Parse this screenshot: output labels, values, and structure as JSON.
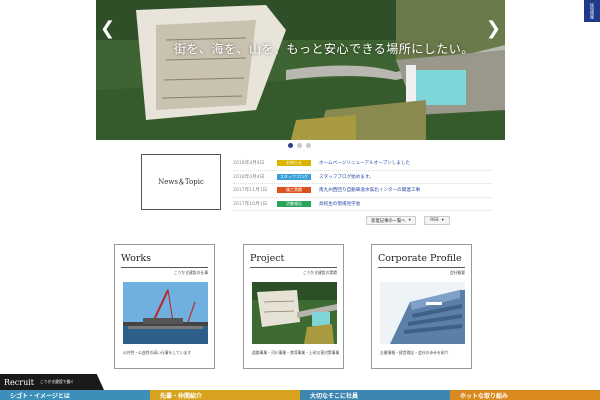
{
  "hero": {
    "tagline": "街を、海を、山を、もっと安心できる場所にしたい。",
    "prev_icon": "chevron-left-icon",
    "next_icon": "chevron-right-icon"
  },
  "slider": {
    "count": 3,
    "active": 0
  },
  "side_tab": {
    "label": "採用情報"
  },
  "news": {
    "heading": "News＆Topic",
    "items": [
      {
        "date": "2018年4月4日",
        "badge": "お知らせ",
        "badge_color": "#d9b500",
        "title": "ホームページリニューアルオープンしました"
      },
      {
        "date": "2018年4月4日",
        "badge": "スタッフブログ",
        "badge_color": "#3a9fd8",
        "title": "スタッフブログ始めます。"
      },
      {
        "date": "2017年11月1日",
        "badge": "施工実績",
        "badge_color": "#d9531e",
        "title": "南九州西回り自動車道水俣北インターの関連工事"
      },
      {
        "date": "2017年10月1日",
        "badge": "活動報告",
        "badge_color": "#2aa35a",
        "title": "高校生の現場見学会"
      }
    ],
    "list_button": "新着記事の一覧へ",
    "rss_button": "RSS"
  },
  "cards": [
    {
      "title": "Works",
      "sub": "こうかき建設の仕事",
      "desc": "公共性・公益性の高い仕事をしています"
    },
    {
      "title": "Project",
      "sub": "こうかき建設の実績",
      "desc": "道路事業・河川事業・港湾事業・上砂災害対策事業"
    },
    {
      "title": "Corporate Profile",
      "sub": "会社概要",
      "desc": "企業情報・経営理念・会社の歩みを紹介"
    }
  ],
  "recruit": {
    "title": "Recruit",
    "sub": "こうかき建設で働く"
  },
  "bottom_strip": [
    {
      "label": "シゴト・イメージとは",
      "color": "#3b8fb8"
    },
    {
      "label": "先輩・仲間紹介",
      "color": "#d9a21e"
    },
    {
      "label": "大切なそこに社員",
      "color": "#3d86b0"
    },
    {
      "label": "ホットな取り組み",
      "color": "#d98a1e"
    }
  ]
}
